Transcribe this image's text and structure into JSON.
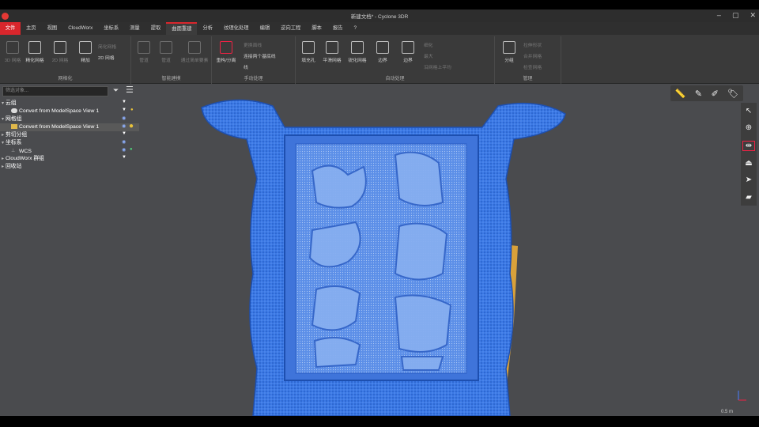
{
  "window": {
    "title": "新建文档* - Cyclone 3DR",
    "app_badge": "3D",
    "controls": [
      "–",
      "▢",
      "✕"
    ]
  },
  "menu": {
    "tabs": [
      "文件",
      "主页",
      "视图",
      "CloudWorx",
      "坐标系",
      "测量",
      "提取",
      "曲面重建",
      "分析",
      "纹理化处理",
      "编辑",
      "逆向工程",
      "脚本",
      "报告",
      "?"
    ],
    "active_index": 7
  },
  "ribbon": {
    "groups": [
      {
        "label": "网格化",
        "buttons": [
          "3D 网格",
          "精化网格",
          "2D 网格",
          "精加",
          "简化网格",
          "2D 网格"
        ]
      },
      {
        "label": "智能建模",
        "buttons": [
          "管道",
          "管道",
          "通过简单要素"
        ]
      },
      {
        "label": "手动处理",
        "buttons": [
          "重构/分离"
        ],
        "small": [
          "更换面线",
          "连接两个基底线",
          "线"
        ]
      },
      {
        "label": "自动处理",
        "buttons": [
          "填充孔",
          "平滑网格",
          "锐化网格",
          "边界",
          "边界"
        ],
        "small": [
          "细化",
          "最大",
          "沿网格上平均"
        ]
      },
      {
        "label": "管理",
        "buttons": [
          "分组"
        ],
        "small": [
          "拉伸形状",
          "合并网格",
          "检查网格"
        ]
      }
    ]
  },
  "tree": {
    "filter_placeholder": "筛选对象...",
    "rows": [
      {
        "label": "云组",
        "indent": 0,
        "caret": "▾"
      },
      {
        "label": "Convert from ModelSpace  View 1",
        "indent": 1,
        "caret": ""
      },
      {
        "label": "网格组",
        "indent": 0,
        "caret": "▾"
      },
      {
        "label": "Convert from ModelSpace  View 1",
        "indent": 1,
        "caret": "",
        "selected": true
      },
      {
        "label": "剪切分组",
        "indent": 0,
        "caret": "▸"
      },
      {
        "label": "坐标系",
        "indent": 0,
        "caret": "▾"
      },
      {
        "label": "WCS",
        "indent": 1,
        "caret": ""
      },
      {
        "label": "CloudWorx 群组",
        "indent": 0,
        "caret": "▸"
      },
      {
        "label": "回收站",
        "indent": 0,
        "caret": "▸"
      }
    ]
  },
  "viewport": {
    "scale_label": "0.5 m",
    "mesh_color": "#2f6fe0",
    "accent_color": "#e0a83a"
  },
  "right_toolbar_icons": [
    "ruler-icon",
    "measure-icon",
    "measure-alt-icon",
    "tag-icon"
  ],
  "side_tool_icons": [
    "cursor-icon",
    "crosshair-icon",
    "fit-icon",
    "camera-icon",
    "send-icon",
    "eraser-icon"
  ]
}
